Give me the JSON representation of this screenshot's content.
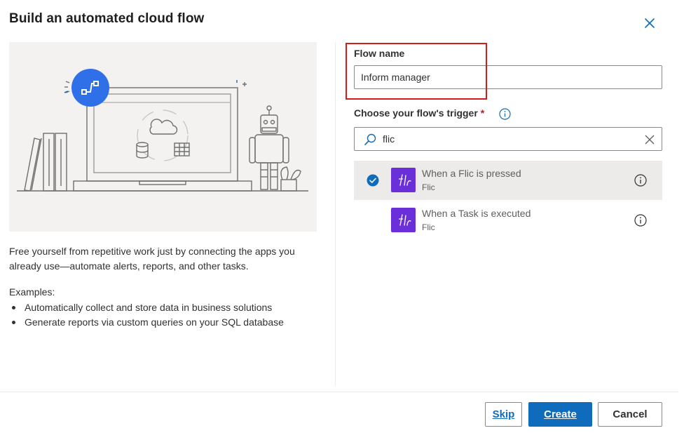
{
  "dialog": {
    "title": "Build an automated cloud flow",
    "close_icon": "close-icon"
  },
  "left": {
    "description": "Free yourself from repetitive work just by connecting the apps you already use—automate alerts, reports, and other tasks.",
    "examples_label": "Examples:",
    "examples": [
      "Automatically collect and store data in business solutions",
      "Generate reports via custom queries on your SQL database"
    ]
  },
  "form": {
    "flow_name_label": "Flow name",
    "flow_name_value": "Inform manager",
    "trigger_label": "Choose your flow's trigger",
    "required_mark": "*",
    "search_value": "flic",
    "search_icon": "search-icon",
    "clear_icon": "clear-icon"
  },
  "triggers": [
    {
      "name": "When a Flic is pressed",
      "connector": "Flic",
      "selected": true
    },
    {
      "name": "When a Task is executed",
      "connector": "Flic",
      "selected": false
    }
  ],
  "footer": {
    "skip_label": "Skip",
    "create_label": "Create",
    "cancel_label": "Cancel"
  },
  "colors": {
    "accent": "#0f6cbd",
    "highlight": "#d01c1c",
    "flic_brand": "#6b2fd9",
    "selected_bg": "#edebe9"
  }
}
